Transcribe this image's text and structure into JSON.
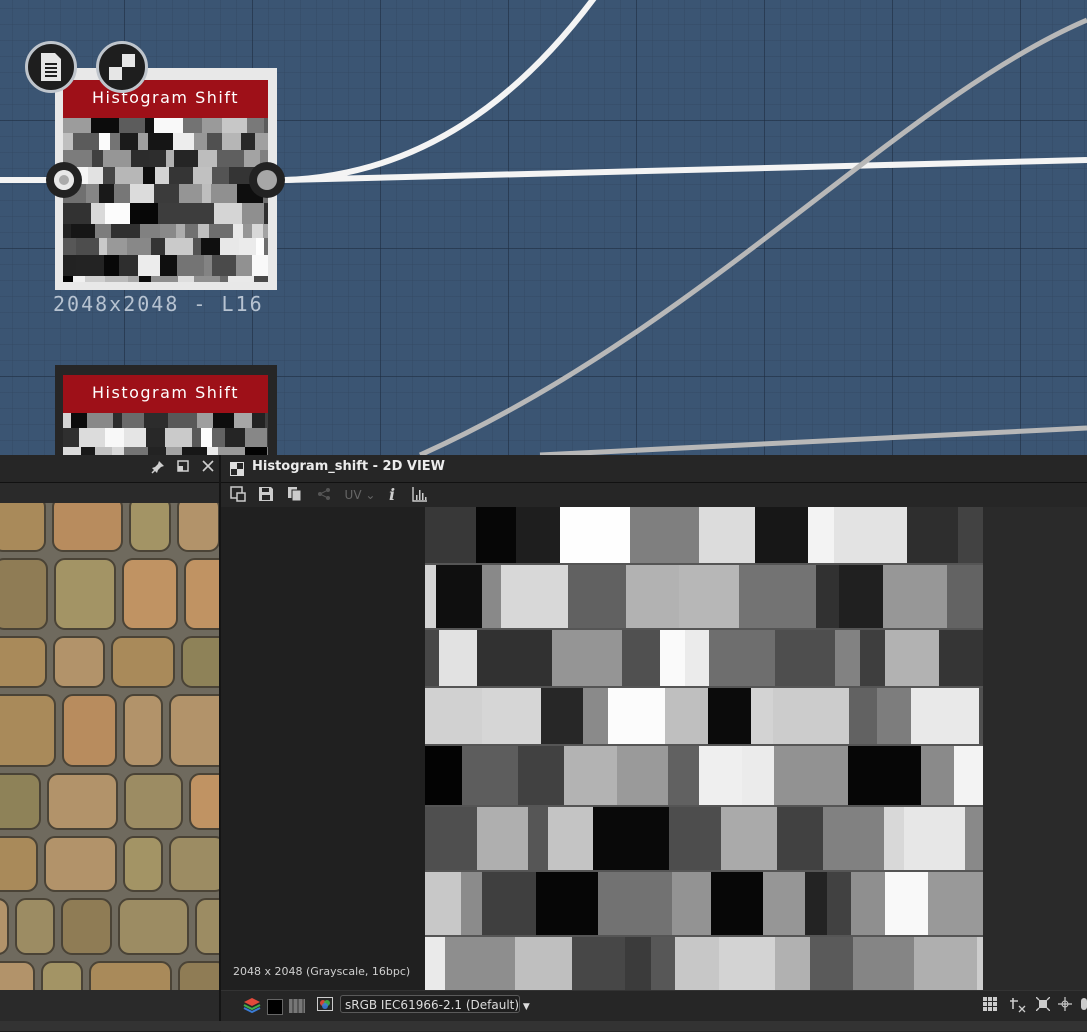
{
  "graph": {
    "nodes": [
      {
        "title": "Histogram Shift",
        "caption": "2048x2048 - L16"
      },
      {
        "title": "Histogram Shift"
      }
    ],
    "badges": [
      "document-icon",
      "checker-icon"
    ]
  },
  "left_panel": {
    "buttons": [
      "pin-icon",
      "float-icon",
      "close-icon"
    ]
  },
  "view2d": {
    "title": "Histogram_shift - 2D VIEW",
    "toolbar": {
      "uv_label": "UV",
      "info_label": "i"
    },
    "image_info": "2048 x 2048 (Grayscale, 16bpc)",
    "status": {
      "colorspace": "sRGB IEC61966-2.1 (Default)"
    }
  }
}
